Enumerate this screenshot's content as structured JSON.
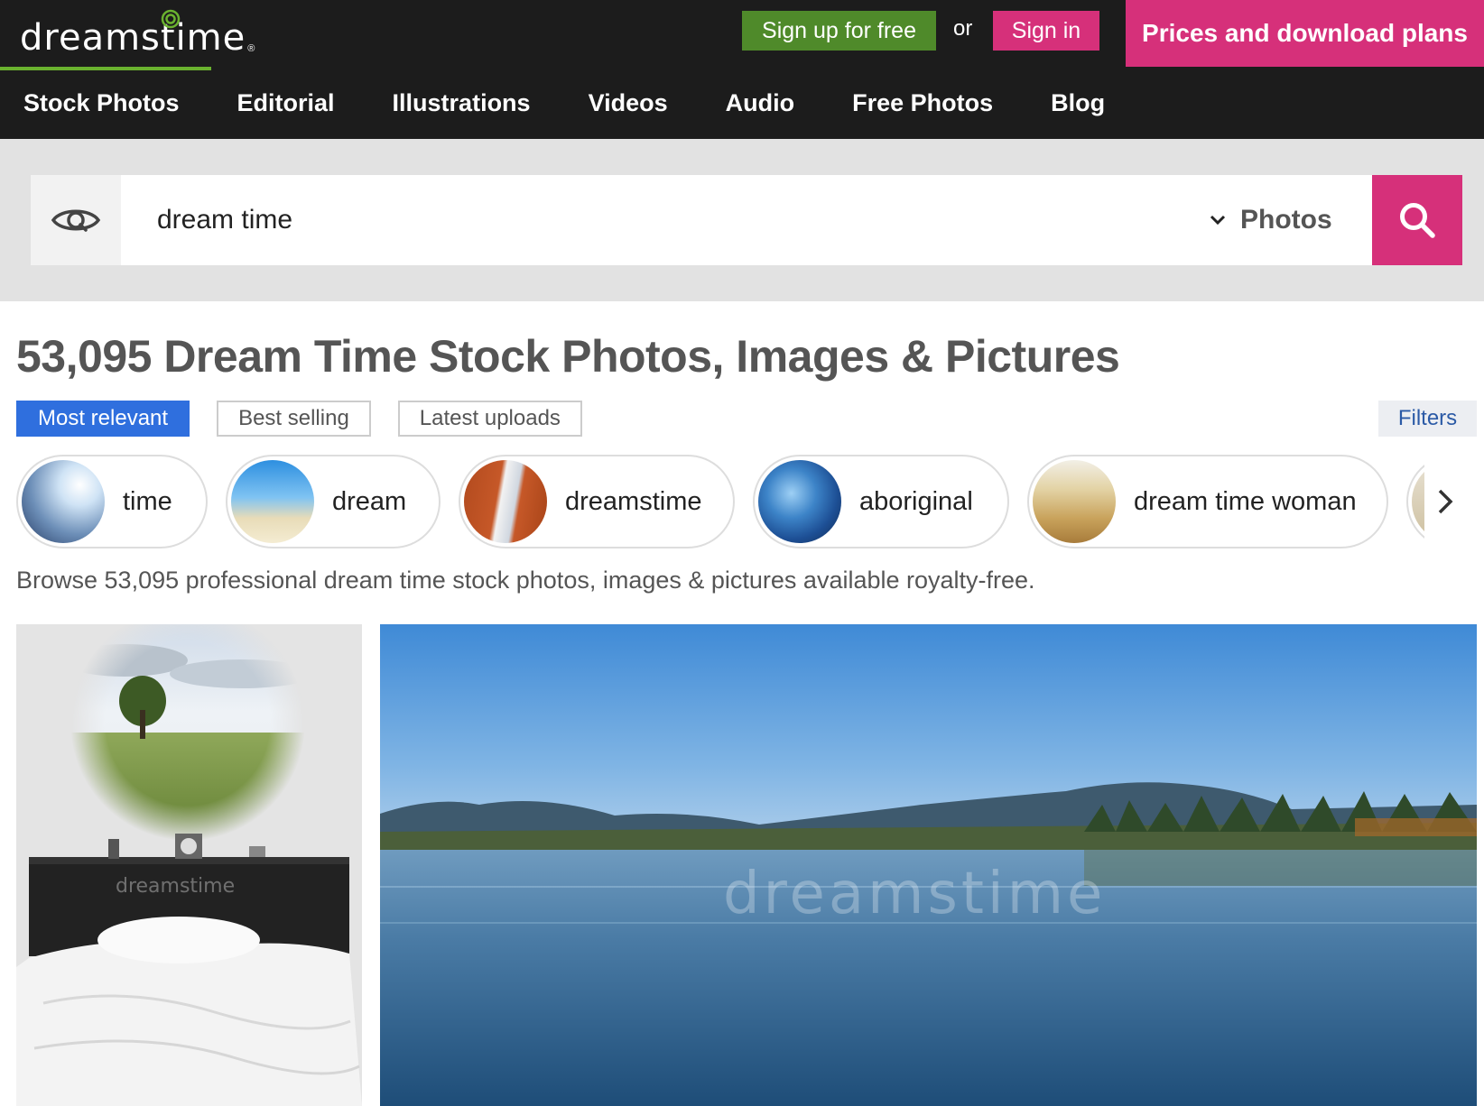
{
  "brand": {
    "logo_text": "dreamstime",
    "logo_mark": "®",
    "colors": {
      "accent_pink": "#d6307a",
      "signup_green": "#4f8a2a",
      "logo_green": "#6ab22f",
      "active_blue": "#2f6fde",
      "topbar_bg": "#1c1c1c"
    }
  },
  "header": {
    "signup_label": "Sign up for free",
    "or_label": "or",
    "signin_label": "Sign in",
    "prices_label": "Prices and download plans"
  },
  "nav": {
    "items": [
      {
        "label": "Stock Photos"
      },
      {
        "label": "Editorial"
      },
      {
        "label": "Illustrations"
      },
      {
        "label": "Videos"
      },
      {
        "label": "Audio"
      },
      {
        "label": "Free Photos"
      },
      {
        "label": "Blog"
      }
    ]
  },
  "search": {
    "value": "dream time",
    "type_label": "Photos",
    "icons": {
      "visual": "eye-icon",
      "dropdown": "chevron-down-icon",
      "submit": "search-icon"
    }
  },
  "results": {
    "title": "53,095 Dream Time Stock Photos, Images & Pictures",
    "description": "Browse 53,095 professional dream time stock photos, images & pictures available royalty-free."
  },
  "sort": {
    "tabs": [
      {
        "label": "Most relevant",
        "active": true
      },
      {
        "label": "Best selling",
        "active": false
      },
      {
        "label": "Latest uploads",
        "active": false
      }
    ],
    "filters_label": "Filters"
  },
  "related": {
    "chips": [
      {
        "label": "time"
      },
      {
        "label": "dream"
      },
      {
        "label": "dreamstime"
      },
      {
        "label": "aboriginal"
      },
      {
        "label": "dream time woman"
      }
    ],
    "next_icon": "chevron-right-icon"
  },
  "gallery": {
    "watermark": "dreamstime"
  }
}
